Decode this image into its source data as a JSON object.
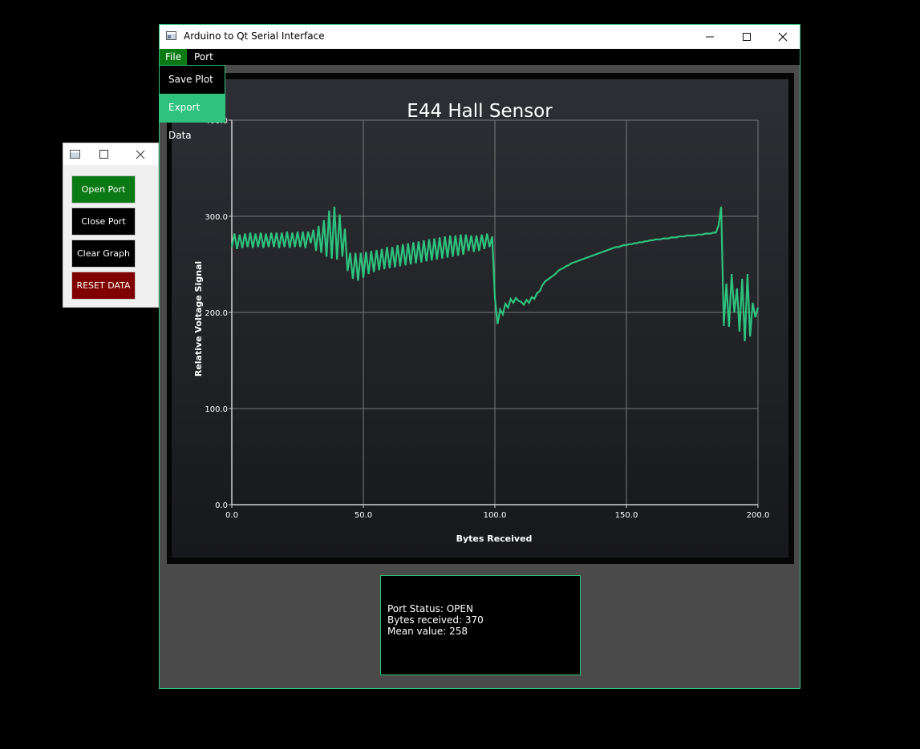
{
  "window": {
    "title": "Arduino to Qt Serial Interface",
    "minimize_icon": "minimize-icon",
    "maximize_icon": "maximize-icon",
    "close_icon": "close-icon"
  },
  "menubar": {
    "file": "File",
    "port": "Port"
  },
  "file_menu": {
    "save_plot": "Save Plot",
    "export_data": "Export Data"
  },
  "controls": {
    "open_port": "Open Port",
    "close_port": "Close Port",
    "clear_graph": "Clear Graph",
    "reset_data": "RESET DATA"
  },
  "status": {
    "port_status": "Port Status: OPEN",
    "bytes_received": "Bytes received: 370",
    "mean_value": "Mean value: 258"
  },
  "colors": {
    "accent": "#2ec27e",
    "open_port_bg": "#0b7a14",
    "reset_bg": "#800000",
    "line": "#2ec27e"
  },
  "chart_data": {
    "type": "line",
    "title": "E44 Hall Sensor",
    "xlabel": "Bytes Received",
    "ylabel": "Relative Voltage Signal",
    "xlim": [
      0,
      200
    ],
    "ylim": [
      0,
      400
    ],
    "x_ticks": [
      "0.0",
      "50.0",
      "100.0",
      "150.0",
      "200.0"
    ],
    "y_ticks": [
      "0.0",
      "100.0",
      "200.0",
      "300.0",
      "400.0"
    ],
    "grid": true,
    "series": [
      {
        "x": [
          0,
          1,
          2,
          3,
          4,
          5,
          6,
          7,
          8,
          9,
          10,
          11,
          12,
          13,
          14,
          15,
          16,
          17,
          18,
          19,
          20,
          21,
          22,
          23,
          24,
          25,
          26,
          27,
          28,
          29,
          30,
          31,
          32,
          33,
          34,
          35,
          36,
          37,
          38,
          39,
          40,
          41,
          42,
          43,
          44,
          45,
          46,
          47,
          48,
          49,
          50,
          51,
          52,
          53,
          54,
          55,
          56,
          57,
          58,
          59,
          60,
          61,
          62,
          63,
          64,
          65,
          66,
          67,
          68,
          69,
          70,
          71,
          72,
          73,
          74,
          75,
          76,
          77,
          78,
          79,
          80,
          81,
          82,
          83,
          84,
          85,
          86,
          87,
          88,
          89,
          90,
          91,
          92,
          93,
          94,
          95,
          96,
          97,
          98,
          99,
          100,
          101,
          102,
          103,
          104,
          105,
          106,
          107,
          108,
          109,
          110,
          111,
          112,
          113,
          114,
          115,
          116,
          117,
          118,
          119,
          120,
          121,
          122,
          123,
          124,
          125,
          126,
          127,
          128,
          129,
          130,
          131,
          132,
          133,
          134,
          135,
          136,
          137,
          138,
          139,
          140,
          141,
          142,
          143,
          144,
          145,
          146,
          147,
          148,
          149,
          150,
          151,
          152,
          153,
          154,
          155,
          156,
          157,
          158,
          159,
          160,
          161,
          162,
          163,
          164,
          165,
          166,
          167,
          168,
          169,
          170,
          171,
          172,
          173,
          174,
          175,
          176,
          177,
          178,
          179,
          180,
          181,
          182,
          183,
          184,
          185,
          186,
          187,
          188,
          189,
          190,
          191,
          192,
          193,
          194,
          195,
          196,
          197,
          198,
          199,
          200
        ],
        "y": [
          268,
          282,
          266,
          281,
          267,
          282,
          268,
          283,
          267,
          282,
          268,
          283,
          267,
          282,
          268,
          283,
          268,
          283,
          267,
          283,
          268,
          284,
          267,
          283,
          268,
          284,
          268,
          284,
          267,
          284,
          272,
          286,
          264,
          290,
          262,
          296,
          258,
          306,
          256,
          310,
          255,
          302,
          258,
          287,
          243,
          262,
          235,
          262,
          233,
          262,
          236,
          263,
          240,
          264,
          242,
          265,
          244,
          266,
          245,
          268,
          246,
          268,
          247,
          270,
          248,
          271,
          249,
          272,
          250,
          273,
          251,
          274,
          252,
          275,
          253,
          276,
          254,
          277,
          255,
          278,
          256,
          279,
          257,
          280,
          258,
          280,
          259,
          281,
          260,
          281,
          264,
          280,
          263,
          280,
          264,
          281,
          266,
          282,
          268,
          279,
          215,
          188,
          203,
          198,
          209,
          205,
          214,
          210,
          215,
          212,
          211,
          208,
          213,
          210,
          216,
          214,
          220,
          222,
          228,
          232,
          234,
          236,
          238,
          240,
          243,
          245,
          246,
          248,
          249,
          251,
          252,
          253,
          254,
          255,
          256,
          257,
          258,
          259,
          260,
          261,
          262,
          263,
          264,
          265,
          266,
          267,
          268,
          268,
          269,
          270,
          270,
          271,
          271,
          272,
          272,
          273,
          273,
          274,
          274,
          275,
          275,
          276,
          276,
          276,
          277,
          277,
          277,
          278,
          278,
          278,
          279,
          279,
          279,
          280,
          280,
          280,
          280,
          281,
          281,
          281,
          282,
          282,
          282,
          283,
          283,
          290,
          310,
          186,
          230,
          185,
          240,
          200,
          225,
          180,
          235,
          170,
          240,
          175,
          210,
          195,
          205
        ]
      }
    ]
  }
}
